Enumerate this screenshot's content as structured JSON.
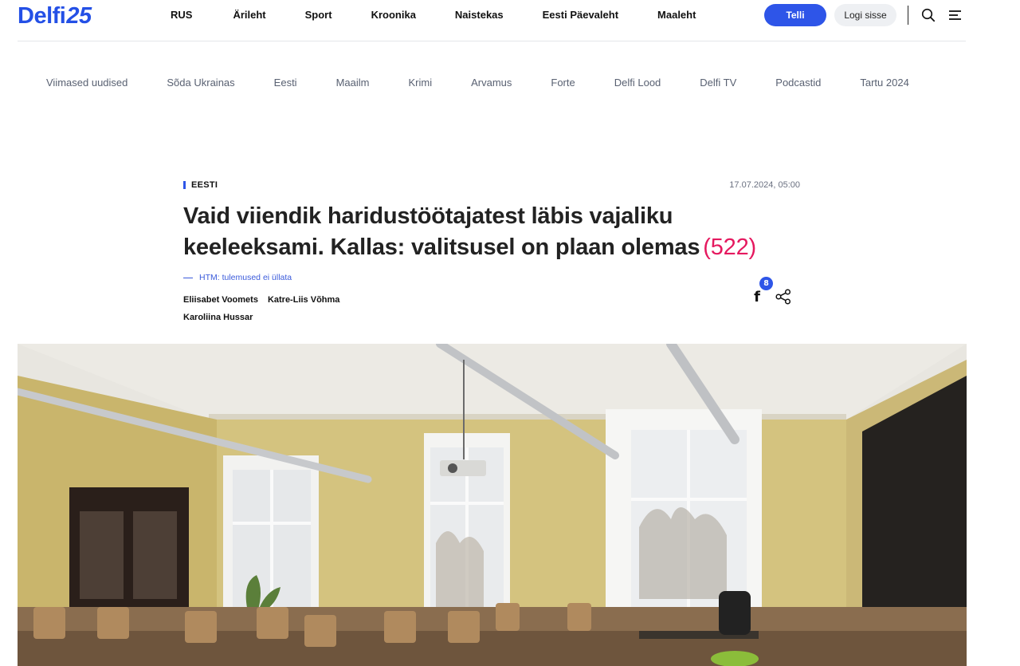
{
  "logo": {
    "text_main": "Delfi",
    "text_num": "25"
  },
  "main_nav": [
    "RUS",
    "Ärileht",
    "Sport",
    "Kroonika",
    "Naistekas",
    "Eesti Päevaleht",
    "Maaleht"
  ],
  "header_actions": {
    "subscribe_label": "Telli",
    "login_label": "Logi sisse"
  },
  "sub_nav": [
    "Viimased uudised",
    "Sõda Ukrainas",
    "Eesti",
    "Maailm",
    "Krimi",
    "Arvamus",
    "Forte",
    "Delfi Lood",
    "Delfi TV",
    "Podcastid",
    "Tartu 2024"
  ],
  "article": {
    "category": "EESTI",
    "date": "17.07.2024, 05:00",
    "title": "Vaid viiendik haridustöötajatest läbis vajaliku keeleeksami. Kallas: valitsusel on plaan olemas",
    "comment_count": "(522)",
    "related_link": "HTM: tulemused ei üllata",
    "authors": [
      "Eliisabet Voomets",
      "Katre-Liis Võhma",
      "Karoliina Hussar"
    ],
    "facebook_count": "8"
  },
  "colors": {
    "accent": "#2e55e8",
    "comment_count": "#e5195f",
    "subnav_text": "#596172"
  },
  "icons": {
    "search": "search-icon",
    "menu": "menu-icon",
    "facebook": "facebook-icon",
    "share": "share-icon"
  }
}
